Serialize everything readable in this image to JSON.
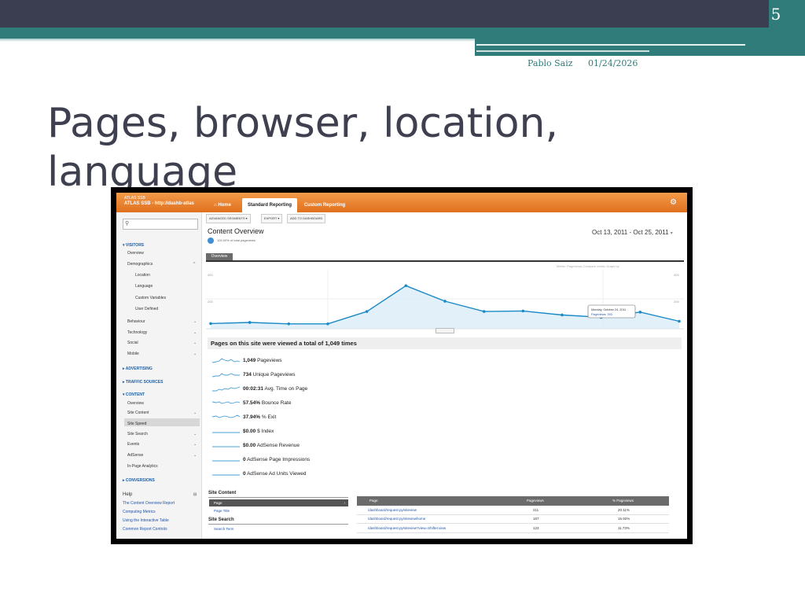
{
  "slide": {
    "number": "5",
    "author": "Pablo Saiz",
    "date": "01/24/2026",
    "title": "Pages, browser, location, language",
    "colors": {
      "dark": "#3b3e50",
      "teal": "#2f7c7a",
      "title": "#3e4050"
    }
  },
  "ga": {
    "account_line1": "ATLAS SSB",
    "account_line2": "ATLAS SSB - http://dashb-atlas",
    "nav": {
      "home": "Home",
      "standard": "Standard Reporting",
      "custom": "Custom Reporting"
    },
    "colors": {
      "orange": "#e97d2b",
      "line": "#1a8ac6",
      "link": "#2255aa"
    },
    "sidebar": {
      "visitors": "▾ VISITORS",
      "overview": "Overview",
      "demographics": "Demographics",
      "location": "Location",
      "language": "Language",
      "custom_variables": "Custom Variables",
      "user_defined": "User Defined",
      "behaviour": "Behaviour",
      "technology": "Technology",
      "social": "Social",
      "mobile": "Mobile",
      "advertising": "▸ ADVERTISING",
      "traffic_sources": "▸ TRAFFIC SOURCES",
      "content": "▾ CONTENT",
      "content_overview": "Overview",
      "site_content": "Site Content",
      "site_speed": "Site Speed",
      "site_search": "Site Search",
      "events": "Events",
      "adsense": "AdSense",
      "in_page": "In-Page Analytics",
      "conversions": "▸ CONVERSIONS",
      "help": "Help",
      "help_links": [
        "The Content Overview Report",
        "Computing Metrics",
        "Using the Interactive Table",
        "Common Report Controls"
      ]
    },
    "toolbar": {
      "segments": "ADVANCED SEGMENTS ▾",
      "export": "EXPORT ▾",
      "dashboard": "ADD TO DASHBOARD"
    },
    "report_title": "Content Overview",
    "pie_label": "100.00% of total pageviews",
    "date_range": "Oct 13, 2011 - Oct 25, 2011",
    "overview_tab": "Overview",
    "chart_options": "Metric: Pageviews     Compare metric     Graph by",
    "chart_data": {
      "type": "area",
      "values": [
        18,
        22,
        17,
        17,
        60,
        150,
        96,
        60,
        62,
        48,
        40,
        58,
        26
      ],
      "ylim": [
        0,
        200
      ],
      "y_ticks": [
        "400",
        "200"
      ],
      "tooltip_date": "Monday, October 24, 2011",
      "tooltip_value": "Pageviews: 393"
    },
    "summary_title": "Pages on this site were viewed a total of 1,049 times",
    "metrics": [
      {
        "value": "1,049",
        "label": "Pageviews"
      },
      {
        "value": "734",
        "label": "Unique Pageviews"
      },
      {
        "value": "00:02:31",
        "label": "Avg. Time on Page"
      },
      {
        "value": "57.54%",
        "label": "Bounce Rate"
      },
      {
        "value": "37.94%",
        "label": "% Exit"
      },
      {
        "value": "$0.00",
        "label": "$ Index"
      },
      {
        "value": "$0.00",
        "label": "AdSense Revenue"
      },
      {
        "value": "0",
        "label": "AdSense Page Impressions"
      },
      {
        "value": "0",
        "label": "AdSense Ad Units Viewed"
      }
    ],
    "bottom": {
      "site_content_title": "Site Content",
      "sc_page": "Page",
      "sc_page_title": "Page Title",
      "site_search_title": "Site Search",
      "ss_term": "Search Term",
      "table_headers": [
        "Page",
        "Pageviews",
        "% Pageviews"
      ],
      "rows": [
        [
          "/dashboard/request.py/siteview",
          "211",
          "20.11%"
        ],
        [
          "/dashboard/request.py/siteviewhome",
          "167",
          "15.92%"
        ],
        [
          "/dashboard/request.py/siteview?view=Shifter.view",
          "123",
          "11.73%"
        ]
      ]
    }
  }
}
